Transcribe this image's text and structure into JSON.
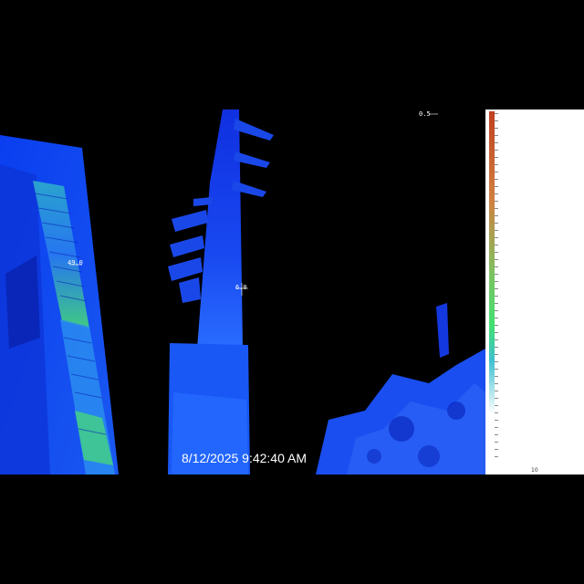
{
  "image": {
    "timestamp": "8/12/2025 9:42:40 AM",
    "spot_labels": {
      "left_marker": "49.0",
      "center_marker": "6.0",
      "top_right": "0.5",
      "scale_bottom": "10"
    },
    "palette": {
      "background": "#000000",
      "cold": "#0a1fd8",
      "mid": "#1e5ef5",
      "warm": "#3fd0d0",
      "hot": "#4ef06a",
      "scale_top": "#c04020"
    }
  }
}
